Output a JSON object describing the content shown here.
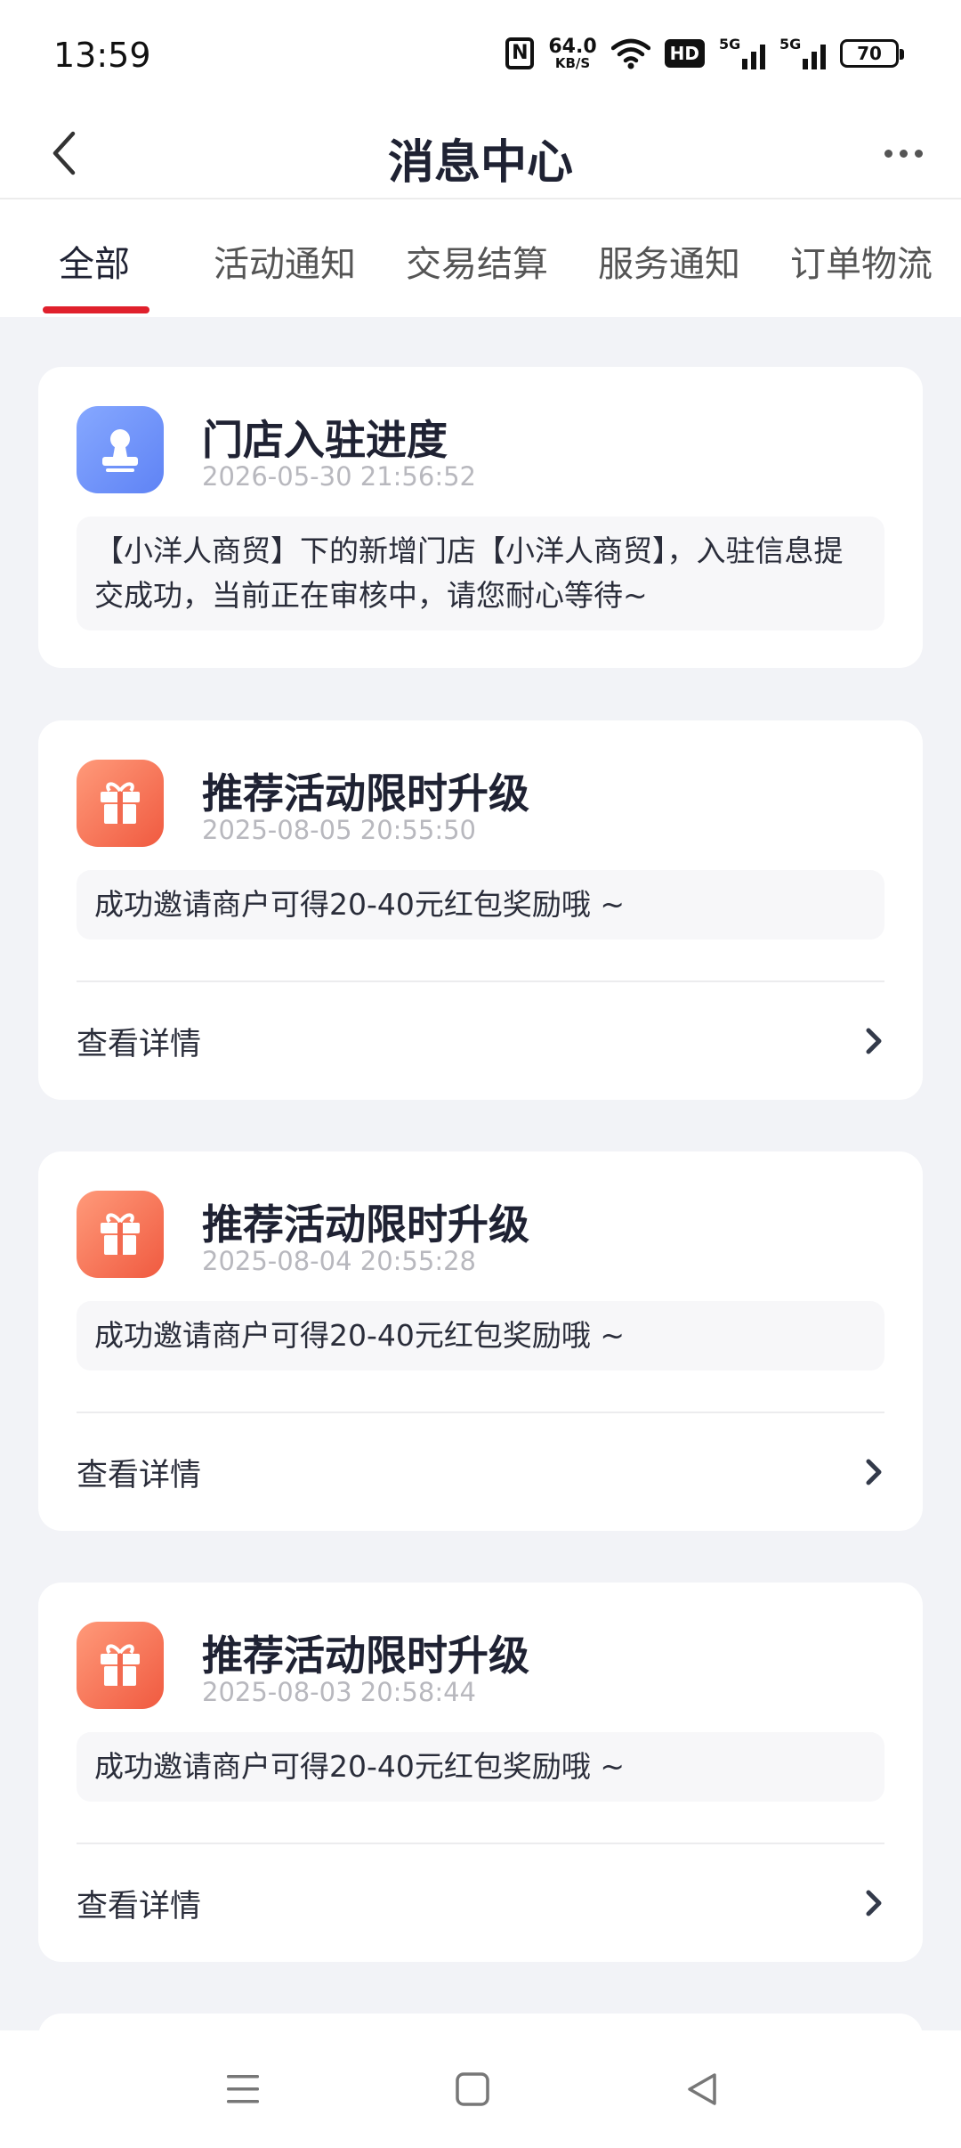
{
  "status_bar": {
    "time": "13:59",
    "nfc_label": "N",
    "net_speed_value": "64.0",
    "net_speed_unit": "KB/S",
    "hd_label": "HD",
    "sim1_label": "5G",
    "sim2_label": "5G",
    "battery": "70"
  },
  "header": {
    "title": "消息中心"
  },
  "tabs": [
    {
      "label": "全部"
    },
    {
      "label": "活动通知"
    },
    {
      "label": "交易结算"
    },
    {
      "label": "服务通知"
    },
    {
      "label": "订单物流"
    }
  ],
  "messages": [
    {
      "icon": "stamp-icon",
      "title": "门店入驻进度",
      "time": "2026-05-30 21:56:52",
      "body": "【小洋人商贸】下的新增门店【小洋人商贸】，入驻信息提交成功，当前正在审核中，请您耐心等待~"
    },
    {
      "icon": "gift-icon",
      "title": "推荐活动限时升级",
      "time": "2025-08-05 20:55:50",
      "body": "成功邀请商户可得20-40元红包奖励哦 ~",
      "link": "查看详情"
    },
    {
      "icon": "gift-icon",
      "title": "推荐活动限时升级",
      "time": "2025-08-04 20:55:28",
      "body": "成功邀请商户可得20-40元红包奖励哦 ~",
      "link": "查看详情"
    },
    {
      "icon": "gift-icon",
      "title": "推荐活动限时升级",
      "time": "2025-08-03 20:58:44",
      "body": "成功邀请商户可得20-40元红包奖励哦 ~",
      "link": "查看详情"
    }
  ],
  "colors": {
    "accent": "#E0202C",
    "background": "#F2F3F7",
    "icon_blue": "#6F93F8",
    "icon_orange": "#F56A4E"
  }
}
